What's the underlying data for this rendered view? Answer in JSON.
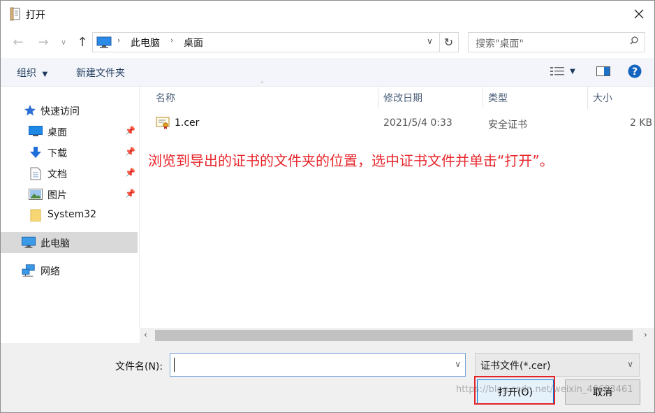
{
  "window": {
    "title": "打开"
  },
  "nav": {
    "breadcrumb": [
      "此电脑",
      "桌面"
    ],
    "search_placeholder": "搜索\"桌面\""
  },
  "toolbar": {
    "organize": "组织",
    "new_folder": "新建文件夹"
  },
  "sidebar": {
    "items": [
      {
        "label": "快速访问",
        "icon": "star-icon"
      },
      {
        "label": "桌面",
        "icon": "desktop-icon",
        "pinned": true
      },
      {
        "label": "下载",
        "icon": "download-icon",
        "pinned": true
      },
      {
        "label": "文档",
        "icon": "document-icon",
        "pinned": true
      },
      {
        "label": "图片",
        "icon": "picture-icon",
        "pinned": true
      },
      {
        "label": "System32",
        "icon": "folder-icon"
      },
      {
        "label": "此电脑",
        "icon": "computer-icon",
        "selected": true
      },
      {
        "label": "网络",
        "icon": "network-icon"
      }
    ]
  },
  "columns": [
    "名称",
    "修改日期",
    "类型",
    "大小"
  ],
  "files": [
    {
      "name": "1.cer",
      "modified": "2021/5/4 0:33",
      "type": "安全证书",
      "size": "2 KB"
    }
  ],
  "annotation": "浏览到导出的证书的文件夹的位置，选中证书文件并单击“打开”。",
  "bottom": {
    "filename_label": "文件名(N):",
    "filename_value": "",
    "filter_value": "证书文件(*.cer)",
    "open_label": "打开(O)",
    "cancel_label": "取消"
  },
  "watermark": "https://blog.csdn.net/weixin_46683461",
  "colors": {
    "accent": "#0078d7",
    "annotation": "#e8262b",
    "highlight_border": "#e0242a"
  }
}
